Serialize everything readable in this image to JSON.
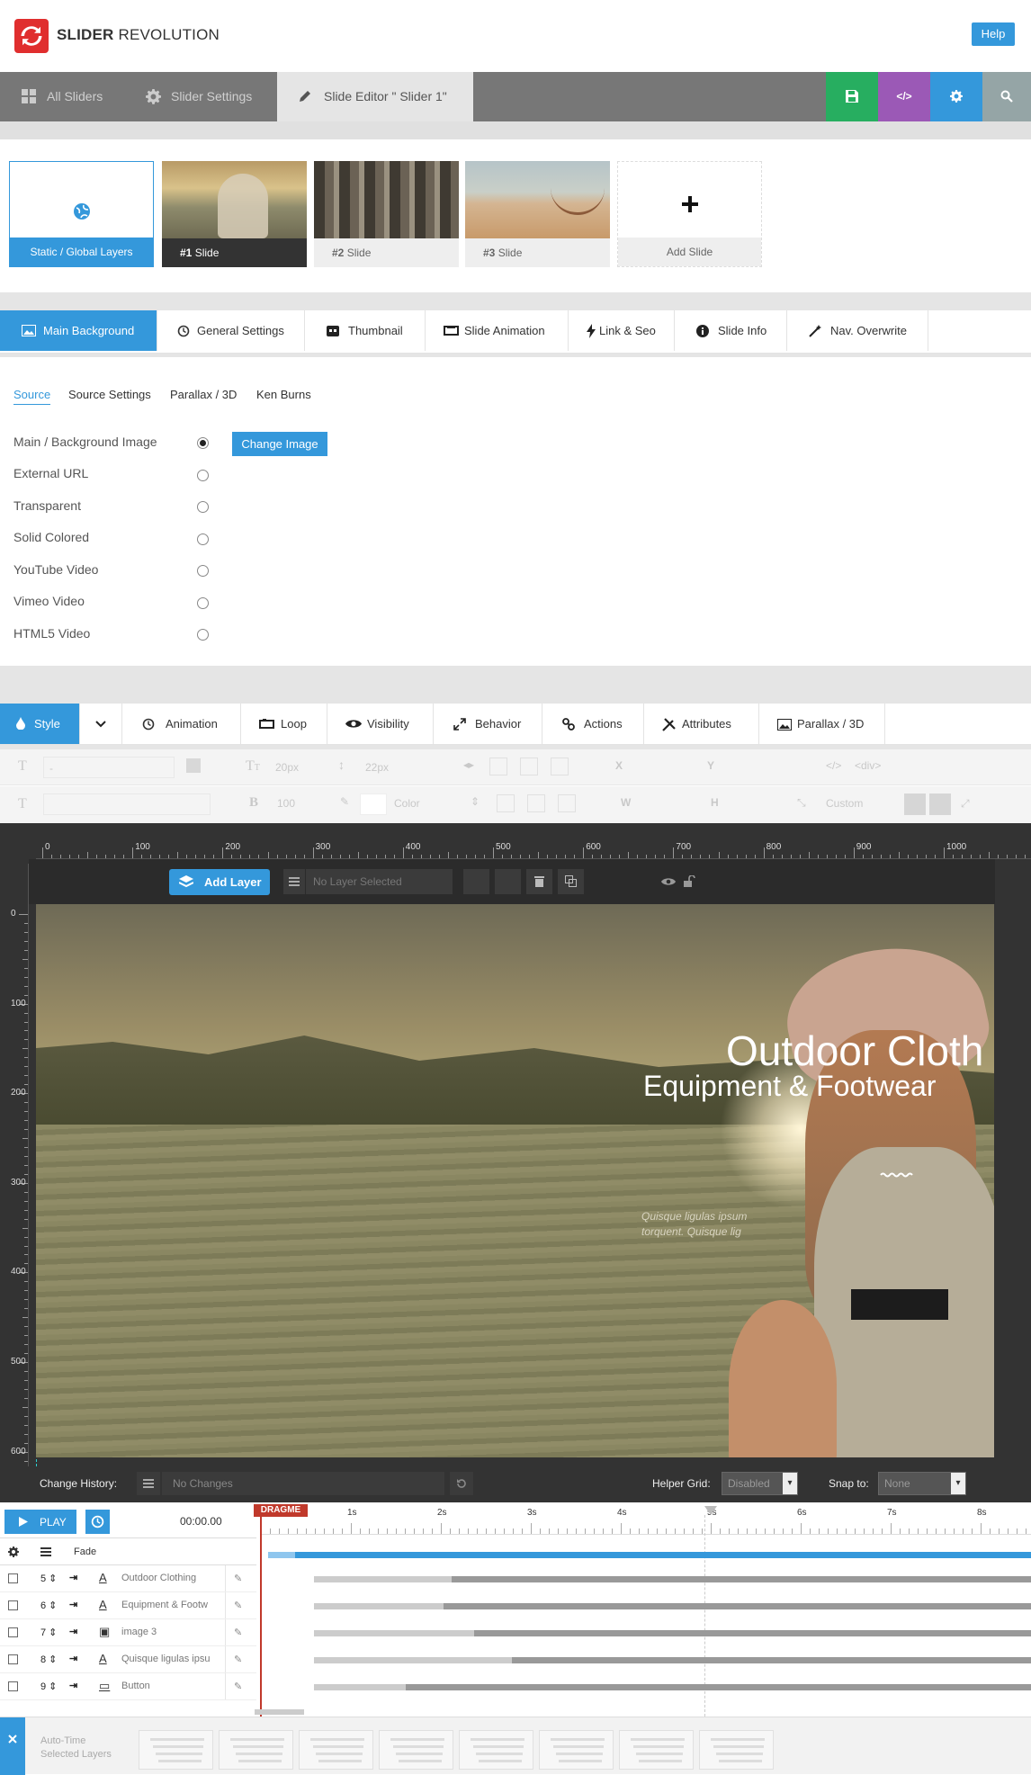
{
  "header": {
    "brand_bold": "SLIDER",
    "brand_light": " REVOLUTION",
    "help_label": "Help"
  },
  "nav": {
    "tabs": [
      {
        "label": "All Sliders",
        "icon": "grid-icon"
      },
      {
        "label": "Slider Settings",
        "icon": "gear-icon"
      },
      {
        "label": "Slide Editor \" Slider 1\"",
        "icon": "pencil-icon"
      }
    ],
    "action_buttons": [
      {
        "name": "save-button",
        "icon": "save-icon",
        "color": "#27ae60"
      },
      {
        "name": "code-button",
        "icon": "code-icon",
        "glyph": "</>",
        "color": "#9b59b6"
      },
      {
        "name": "settings-button",
        "icon": "gear-icon",
        "color": "#3498db"
      },
      {
        "name": "search-button",
        "icon": "search-icon",
        "color": "#95a5a6"
      }
    ]
  },
  "slides": [
    {
      "label": "Static / Global Layers",
      "icon": "globe-icon"
    },
    {
      "label_num": "#1",
      "label": " Slide"
    },
    {
      "label_num": "#2",
      "label": " Slide"
    },
    {
      "label_num": "#3",
      "label": " Slide"
    },
    {
      "label": "Add Slide",
      "icon": "plus-icon"
    }
  ],
  "slide_tabs": [
    {
      "label": "Main Background",
      "icon": "image-icon"
    },
    {
      "label": "General Settings",
      "icon": "history-icon"
    },
    {
      "label": "Thumbnail",
      "icon": "thumbnail-icon"
    },
    {
      "label": "Slide Animation",
      "icon": "film-icon"
    },
    {
      "label": "Link & Seo",
      "icon": "bolt-icon"
    },
    {
      "label": "Slide Info",
      "icon": "info-icon"
    },
    {
      "label": "Nav. Overwrite",
      "icon": "wand-icon"
    }
  ],
  "bg_subtabs": [
    "Source",
    "Source Settings",
    "Parallax / 3D",
    "Ken Burns"
  ],
  "bg_sources": [
    {
      "label": "Main / Background Image",
      "selected": true
    },
    {
      "label": "External URL",
      "selected": false
    },
    {
      "label": "Transparent",
      "selected": false
    },
    {
      "label": "Solid Colored",
      "selected": false
    },
    {
      "label": "YouTube Video",
      "selected": false
    },
    {
      "label": "Vimeo Video",
      "selected": false
    },
    {
      "label": "HTML5 Video",
      "selected": false
    }
  ],
  "change_image_label": "Change Image",
  "layer_tabs": [
    {
      "label": "Style",
      "icon": "drop-icon"
    },
    {
      "label": "",
      "icon": "chevron-down-icon"
    },
    {
      "label": "Animation",
      "icon": "history-icon"
    },
    {
      "label": "Loop",
      "icon": "loop-icon"
    },
    {
      "label": "Visibility",
      "icon": "eye-icon"
    },
    {
      "label": "Behavior",
      "icon": "expand-icon"
    },
    {
      "label": "Actions",
      "icon": "link-icon"
    },
    {
      "label": "Attributes",
      "icon": "tools-icon"
    },
    {
      "label": "Parallax / 3D",
      "icon": "image-icon"
    }
  ],
  "toolbar": {
    "font_size": "20px",
    "line_height": "22px",
    "font_weight": "100",
    "color_label": "Color",
    "x_label": "X",
    "y_label": "Y",
    "w_label": "W",
    "h_label": "H",
    "tag": "<div>",
    "custom": "Custom",
    "dash": "-"
  },
  "ruler_top": [
    "0",
    "100",
    "200",
    "300",
    "400",
    "500",
    "600",
    "700",
    "800",
    "900",
    "1000"
  ],
  "ruler_left": [
    "0",
    "100",
    "200",
    "300",
    "400",
    "500",
    "600"
  ],
  "editor": {
    "add_layer_label": "Add Layer",
    "no_layer_label": "No Layer Selected"
  },
  "canvas_text": {
    "title": "Outdoor Cloth",
    "subtitle": "Equipment & Footwear",
    "para1": "Quisque ligulas ipsum",
    "para2": "torquent. Quisque lig"
  },
  "bottombar": {
    "history_label": "Change History:",
    "history_value": "No Changes",
    "grid_label": "Helper Grid:",
    "grid_value": "Disabled",
    "snap_label": "Snap to:",
    "snap_value": "None"
  },
  "timeline": {
    "play_label": "PLAY",
    "time": "00:00.00",
    "dragme": "DRAGME",
    "seconds": [
      "1s",
      "2s",
      "3s",
      "4s",
      "5s",
      "6s",
      "7s",
      "8s"
    ],
    "transition": "Fade",
    "layers": [
      {
        "num": "5",
        "label": "Outdoor Clothing",
        "type": "text-icon",
        "start": 0.06,
        "anim": 0.24
      },
      {
        "num": "6",
        "label": "Equipment & Footw",
        "type": "text-icon",
        "start": 0.06,
        "anim": 0.23
      },
      {
        "num": "7",
        "label": "image 3",
        "type": "image-icon",
        "start": 0.06,
        "anim": 0.27
      },
      {
        "num": "8",
        "label": "Quisque ligulas ipsu",
        "type": "text-icon",
        "start": 0.06,
        "anim": 0.32
      },
      {
        "num": "9",
        "label": "Button",
        "type": "button-icon",
        "start": 0.06,
        "anim": 0.18
      }
    ]
  },
  "autotime": {
    "label1": "Auto-Time",
    "label2": "Selected Layers"
  }
}
